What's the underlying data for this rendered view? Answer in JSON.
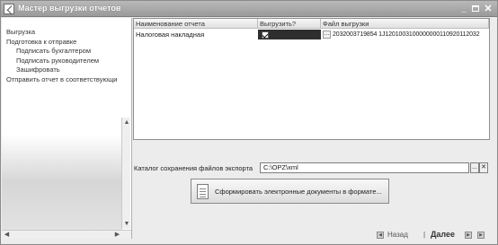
{
  "window": {
    "title": "Мастер выгрузки отчетов",
    "min_glyph": "_",
    "close_glyph": "✕"
  },
  "steps": [
    {
      "label": "Выгрузка",
      "sub": false
    },
    {
      "label": "Подготовка к отправке",
      "sub": false
    },
    {
      "label": "Подписать бухгалтером",
      "sub": true
    },
    {
      "label": "Подписать руководителем",
      "sub": true
    },
    {
      "label": "Зашифровать",
      "sub": true
    },
    {
      "label": "Отправить отчет в соответствующи",
      "sub": false
    }
  ],
  "grid": {
    "columns": [
      "Наименование отчета",
      "Выгрузить?",
      "Файл выгрузки"
    ],
    "rows": [
      {
        "name": "Налоговая накладная",
        "export": true,
        "file": "2032003719854 1J1201003100000000110920112032"
      }
    ]
  },
  "export": {
    "label": "Каталог сохранения файлов экспорта",
    "path": "C:\\OPZ\\xml",
    "browse_glyph": "...",
    "clear_glyph": "✕"
  },
  "generate_button": {
    "label": "Сформировать электронные документы в формате..."
  },
  "nav": {
    "back": "Назад",
    "separator": "|",
    "next": "Далее"
  },
  "colors": {
    "titlebar": "#a8a8a8",
    "selected_cell": "#2e2e2e"
  }
}
